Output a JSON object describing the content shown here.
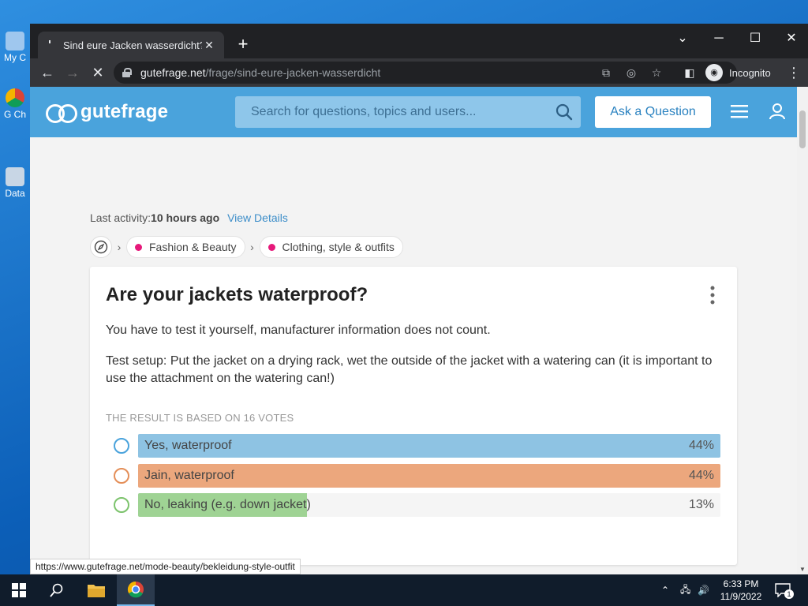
{
  "desktop": {
    "icons": [
      {
        "label": "My C",
        "name": "my-computer"
      },
      {
        "label": "G Ch",
        "name": "google-chrome"
      },
      {
        "label": "Data",
        "name": "data"
      }
    ]
  },
  "browser": {
    "tab_title": "Sind eure Jacken wasserdicht? (K",
    "url_host": "gutefrage.net",
    "url_path": "/frage/sind-eure-jacken-wasserdicht",
    "profile_label": "Incognito"
  },
  "site": {
    "logo_text": "gutefrage",
    "search_placeholder": "Search for questions, topics and users...",
    "ask_button": "Ask a Question",
    "brand_color": "#4aa3dc"
  },
  "question": {
    "last_activity_label": "Last activity:",
    "last_activity_value": "10 hours ago",
    "view_details": "View Details",
    "breadcrumbs": [
      "Fashion & Beauty",
      "Clothing, style & outfits"
    ],
    "title": "Are your jackets waterproof?",
    "body": [
      "You have to test it yourself, manufacturer information does not count.",
      "Test setup: Put the jacket on a drying rack, wet the outside of the jacket with a watering can (it is important to use the attachment on the watering can!)"
    ],
    "result_label": "THE RESULT IS BASED ON 16 VOTES",
    "poll": [
      {
        "label": "Yes, waterproof",
        "percent": "44%",
        "fill": 1.0,
        "color": "#8ec3e3",
        "radio_color": "#4aa3dc"
      },
      {
        "label": "Jain, waterproof",
        "percent": "44%",
        "fill": 1.0,
        "color": "#eca77d",
        "radio_color": "#e48e58"
      },
      {
        "label": "No, leaking (e.g. down jacket)",
        "percent": "13%",
        "fill": 0.29,
        "color": "#9fd394",
        "radio_color": "#7cc36c"
      }
    ]
  },
  "status_bar_url": "https://www.gutefrage.net/mode-beauty/bekleidung-style-outfit",
  "taskbar": {
    "time": "6:33 PM",
    "date": "11/9/2022",
    "notification_count": "1"
  }
}
